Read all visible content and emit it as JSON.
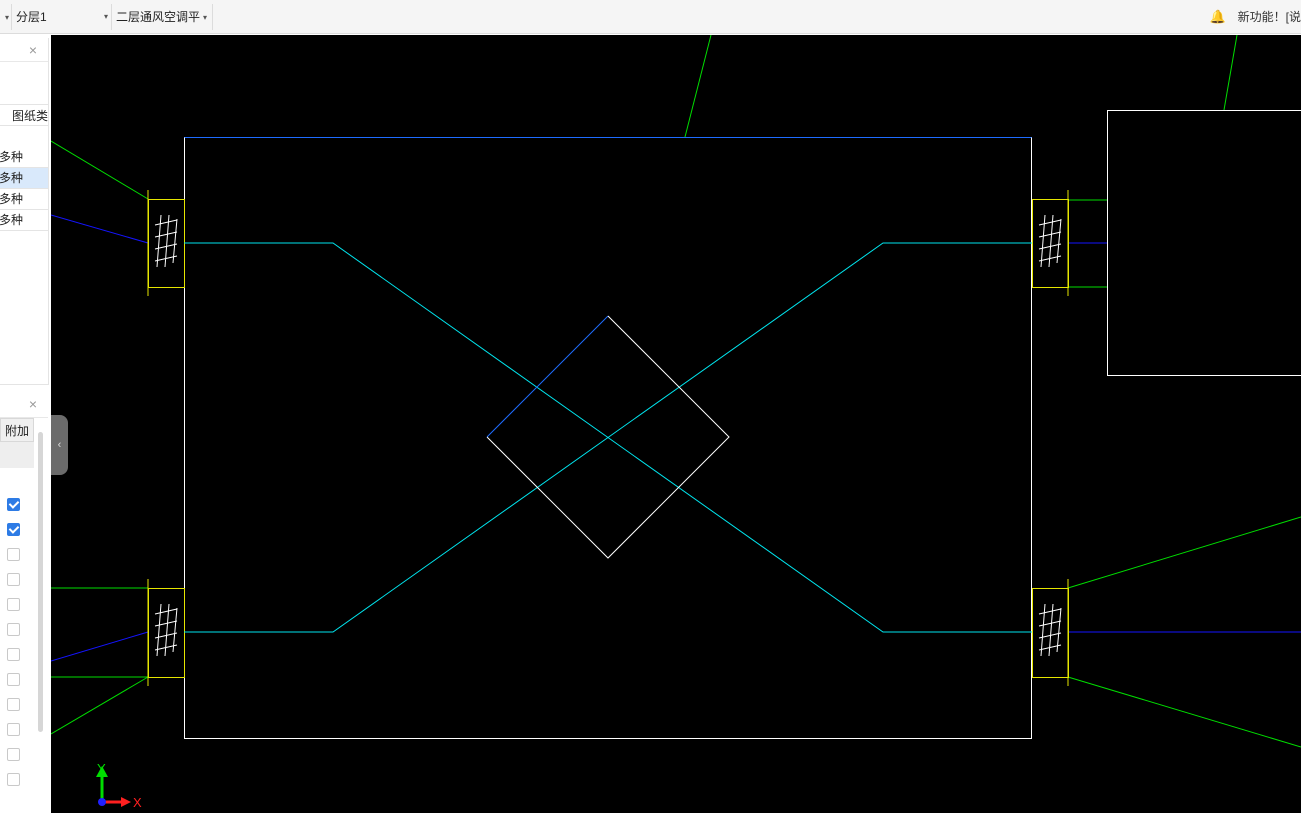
{
  "toolbar": {
    "layer_dropdown": "分层1",
    "drawing_dropdown": "二层通风空调平",
    "notice_text": "新功能！[说"
  },
  "left_panel": {
    "column_header": "图纸类",
    "rows": [
      "多种",
      "多种",
      "多种",
      "多种"
    ],
    "add_tab": "附加",
    "checkboxes": [
      true,
      true,
      false,
      false,
      false,
      false,
      false,
      false,
      false,
      false,
      false,
      false
    ]
  },
  "canvas": {
    "axis_x": "X",
    "axis_y": "Y",
    "colors": {
      "background": "#000000",
      "outline": "#ffffff",
      "duct": "#00e5ee",
      "leader": "#00dd00",
      "pipe": "#0000ff",
      "accent_blue": "#1e6cff",
      "flange": "#e6e600"
    }
  }
}
